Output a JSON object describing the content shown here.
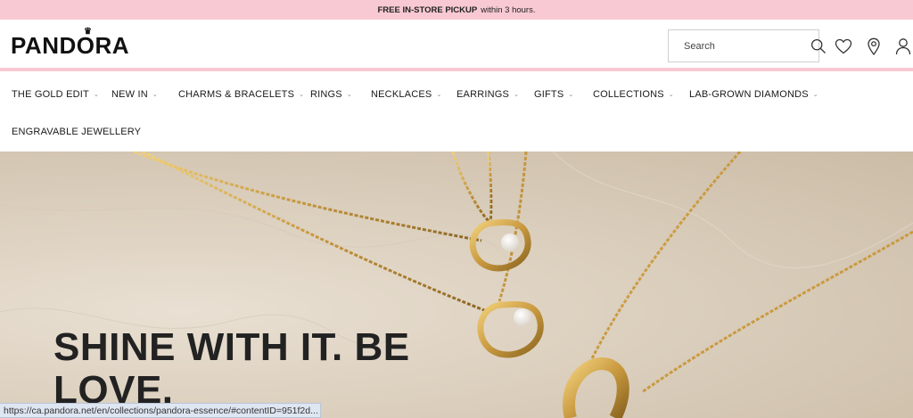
{
  "promo": {
    "bold": "FREE IN-STORE PICKUP",
    "rest": "within 3 hours."
  },
  "header": {
    "logo": "PANDORA",
    "search_placeholder": "Search",
    "icons": [
      "search-icon",
      "heart-icon",
      "location-pin-icon",
      "user-icon"
    ]
  },
  "nav": {
    "items": [
      {
        "label": "THE GOLD EDIT",
        "chevron": true
      },
      {
        "label": "NEW IN",
        "chevron": true
      },
      {
        "label": "CHARMS & BRACELETS",
        "chevron": true
      },
      {
        "label": "RINGS",
        "chevron": true
      },
      {
        "label": "NECKLACES",
        "chevron": true
      },
      {
        "label": "EARRINGS",
        "chevron": true
      },
      {
        "label": "GIFTS",
        "chevron": true
      },
      {
        "label": "COLLECTIONS",
        "chevron": true
      },
      {
        "label": "LAB-GROWN DIAMONDS",
        "chevron": true
      },
      {
        "label": "ENGRAVABLE JEWELLERY",
        "chevron": false
      }
    ],
    "chevron_glyph": "⌄"
  },
  "hero": {
    "headline": "SHINE WITH IT. BE LOVE."
  },
  "status_bar": {
    "url": "https://ca.pandora.net/en/collections/pandora-essence/#contentID=951f2d..."
  },
  "colors": {
    "promo_bg": "#f8c9d3",
    "gold": "#c9993f",
    "text": "#1a1a1a"
  }
}
